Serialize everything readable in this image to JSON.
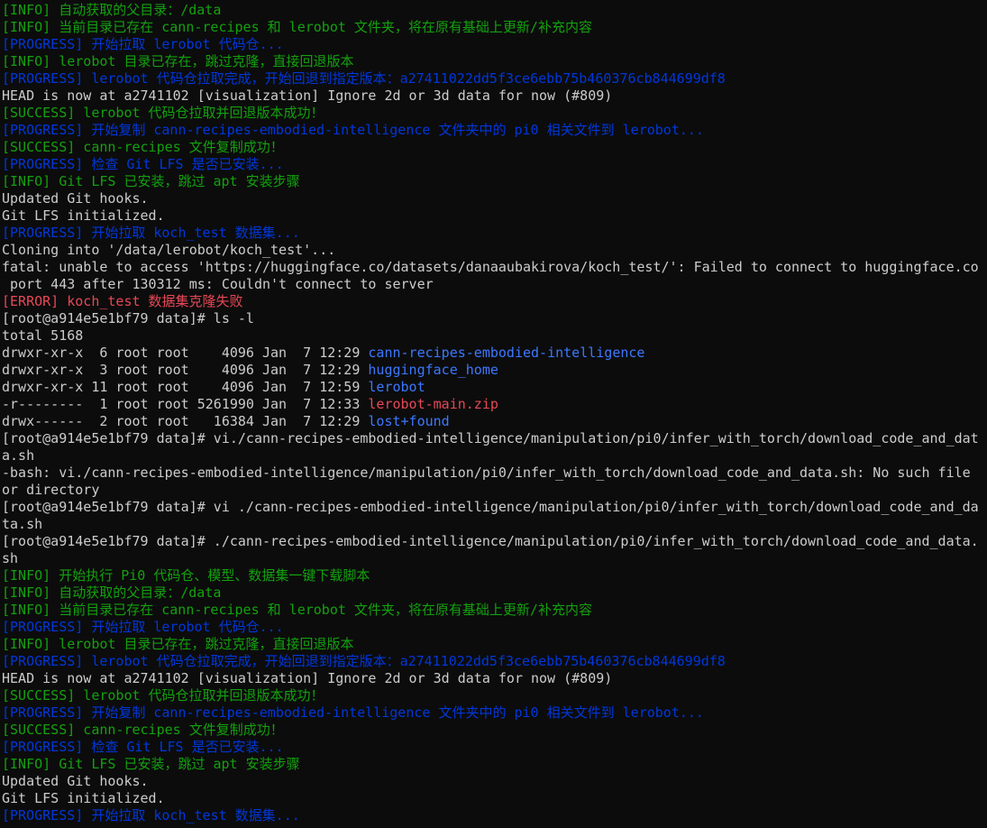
{
  "terminal": {
    "colors": {
      "background": "#0c0c0c",
      "default": "#cccccc",
      "green": "#13a10e",
      "blue": "#0037da",
      "red": "#e74856",
      "dir_blue": "#3b78ff"
    },
    "lines": [
      {
        "color": "green",
        "text": "[INFO] 自动获取的父目录：/data"
      },
      {
        "color": "green",
        "text": "[INFO] 当前目录已存在 cann-recipes 和 lerobot 文件夹，将在原有基础上更新/补充内容"
      },
      {
        "color": "blue",
        "text": "[PROGRESS] 开始拉取 lerobot 代码仓..."
      },
      {
        "color": "green",
        "text": "[INFO] lerobot 目录已存在，跳过克隆，直接回退版本"
      },
      {
        "color": "blue",
        "text": "[PROGRESS] lerobot 代码仓拉取完成，开始回退到指定版本：a27411022dd5f3ce6ebb75b460376cb844699df8"
      },
      {
        "color": "default",
        "text": "HEAD is now at a2741102 [visualization] Ignore 2d or 3d data for now (#809)"
      },
      {
        "color": "green",
        "text": "[SUCCESS] lerobot 代码仓拉取并回退版本成功！"
      },
      {
        "color": "blue",
        "text": "[PROGRESS] 开始复制 cann-recipes-embodied-intelligence 文件夹中的 pi0 相关文件到 lerobot..."
      },
      {
        "color": "green",
        "text": "[SUCCESS] cann-recipes 文件复制成功！"
      },
      {
        "color": "blue",
        "text": "[PROGRESS] 检查 Git LFS 是否已安装..."
      },
      {
        "color": "green",
        "text": "[INFO] Git LFS 已安装，跳过 apt 安装步骤"
      },
      {
        "color": "default",
        "text": "Updated Git hooks."
      },
      {
        "color": "default",
        "text": "Git LFS initialized."
      },
      {
        "color": "blue",
        "text": "[PROGRESS] 开始拉取 koch_test 数据集..."
      },
      {
        "color": "default",
        "text": "Cloning into '/data/lerobot/koch_test'..."
      },
      {
        "color": "default",
        "text": "fatal: unable to access 'https://huggingface.co/datasets/danaaubakirova/koch_test/': Failed to connect to huggingface.co"
      },
      {
        "color": "default",
        "text": " port 443 after 130312 ms: Couldn't connect to server"
      },
      {
        "color": "red",
        "text": "[ERROR] koch_test 数据集克隆失败"
      },
      {
        "color": "default",
        "text": "[root@a914e5e1bf79 data]# ls -l"
      },
      {
        "color": "default",
        "text": "total 5168"
      },
      {
        "color": "default",
        "text": "drwxr-xr-x  6 root root    4096 Jan  7 12:29 ",
        "tail": "cann-recipes-embodied-intelligence",
        "tail_color": "dirblue"
      },
      {
        "color": "default",
        "text": "drwxr-xr-x  3 root root    4096 Jan  7 12:29 ",
        "tail": "huggingface_home",
        "tail_color": "dirblue"
      },
      {
        "color": "default",
        "text": "drwxr-xr-x 11 root root    4096 Jan  7 12:59 ",
        "tail": "lerobot",
        "tail_color": "dirblue"
      },
      {
        "color": "default",
        "text": "-r--------  1 root root 5261990 Jan  7 12:33 ",
        "tail": "lerobot-main.zip",
        "tail_color": "zipred"
      },
      {
        "color": "default",
        "text": "drwx------  2 root root   16384 Jan  7 12:29 ",
        "tail": "lost+found",
        "tail_color": "dirblue"
      },
      {
        "color": "default",
        "text": "[root@a914e5e1bf79 data]# vi./cann-recipes-embodied-intelligence/manipulation/pi0/infer_with_torch/download_code_and_dat"
      },
      {
        "color": "default",
        "text": "a.sh"
      },
      {
        "color": "default",
        "text": "-bash: vi./cann-recipes-embodied-intelligence/manipulation/pi0/infer_with_torch/download_code_and_data.sh: No such file"
      },
      {
        "color": "default",
        "text": "or directory"
      },
      {
        "color": "default",
        "text": "[root@a914e5e1bf79 data]# vi ./cann-recipes-embodied-intelligence/manipulation/pi0/infer_with_torch/download_code_and_da"
      },
      {
        "color": "default",
        "text": "ta.sh"
      },
      {
        "color": "default",
        "text": "[root@a914e5e1bf79 data]# ./cann-recipes-embodied-intelligence/manipulation/pi0/infer_with_torch/download_code_and_data."
      },
      {
        "color": "default",
        "text": "sh"
      },
      {
        "color": "green",
        "text": "[INFO] 开始执行 Pi0 代码仓、模型、数据集一键下载脚本"
      },
      {
        "color": "green",
        "text": "[INFO] 自动获取的父目录：/data"
      },
      {
        "color": "green",
        "text": "[INFO] 当前目录已存在 cann-recipes 和 lerobot 文件夹，将在原有基础上更新/补充内容"
      },
      {
        "color": "blue",
        "text": "[PROGRESS] 开始拉取 lerobot 代码仓..."
      },
      {
        "color": "green",
        "text": "[INFO] lerobot 目录已存在，跳过克隆，直接回退版本"
      },
      {
        "color": "blue",
        "text": "[PROGRESS] lerobot 代码仓拉取完成，开始回退到指定版本：a27411022dd5f3ce6ebb75b460376cb844699df8"
      },
      {
        "color": "default",
        "text": "HEAD is now at a2741102 [visualization] Ignore 2d or 3d data for now (#809)"
      },
      {
        "color": "green",
        "text": "[SUCCESS] lerobot 代码仓拉取并回退版本成功！"
      },
      {
        "color": "blue",
        "text": "[PROGRESS] 开始复制 cann-recipes-embodied-intelligence 文件夹中的 pi0 相关文件到 lerobot..."
      },
      {
        "color": "green",
        "text": "[SUCCESS] cann-recipes 文件复制成功！"
      },
      {
        "color": "blue",
        "text": "[PROGRESS] 检查 Git LFS 是否已安装..."
      },
      {
        "color": "green",
        "text": "[INFO] Git LFS 已安装，跳过 apt 安装步骤"
      },
      {
        "color": "default",
        "text": "Updated Git hooks."
      },
      {
        "color": "default",
        "text": "Git LFS initialized."
      },
      {
        "color": "blue",
        "text": "[PROGRESS] 开始拉取 koch_test 数据集..."
      }
    ]
  }
}
